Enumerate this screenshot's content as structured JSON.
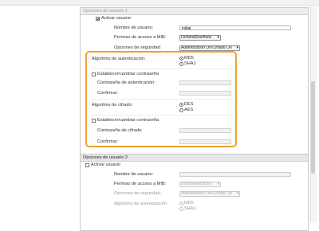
{
  "section1": {
    "title": "Opciones de usuario 1",
    "activate_label": "Activar usuario",
    "activate_checked": true,
    "username_label": "Nombre de usuario:",
    "username_value": "initial",
    "mib_label": "Permiso de acceso a MIB:",
    "mib_value": "Lectura/Escritura",
    "security_label": "Opciones de seguridad:",
    "security_value": "Autenticación On/Cifrado On",
    "auth_algo_label": "Algoritmo de autenticación:",
    "auth_algo_options": [
      "MD5",
      "SHA1"
    ],
    "auth_algo_selected": "MD5",
    "set_auth_pwd_label": "Establecer/cambiar contraseña",
    "auth_pwd_label": "Contraseña de autenticación:",
    "confirm_label": "Confirmar:",
    "encrypt_algo_label": "Algoritmo de cifrado:",
    "encrypt_algo_options": [
      "DES",
      "AES"
    ],
    "encrypt_algo_selected": "DES",
    "set_encrypt_pwd_label": "Establecer/cambiar contraseña",
    "encrypt_pwd_label": "Contraseña de cifrado:",
    "confirm2_label": "Confirmar:"
  },
  "section2": {
    "title": "Opciones de usuario 2",
    "activate_label": "Activar usuario",
    "activate_checked": false,
    "username_label": "Nombre de usuario:",
    "username_value": "",
    "mib_label": "Permiso de acceso a MIB:",
    "mib_value": "Lectura/Escritura",
    "security_label": "Opciones de seguridad:",
    "security_value": "Autenticación On/Cifrado On",
    "auth_algo_label": "Algoritmo de autenticación:",
    "auth_algo_options": [
      "MD5",
      "SHA1"
    ],
    "auth_algo_selected": "MD5"
  },
  "colors": {
    "highlight": "#f0a030",
    "section_header_bg": "#e6e6e6"
  }
}
